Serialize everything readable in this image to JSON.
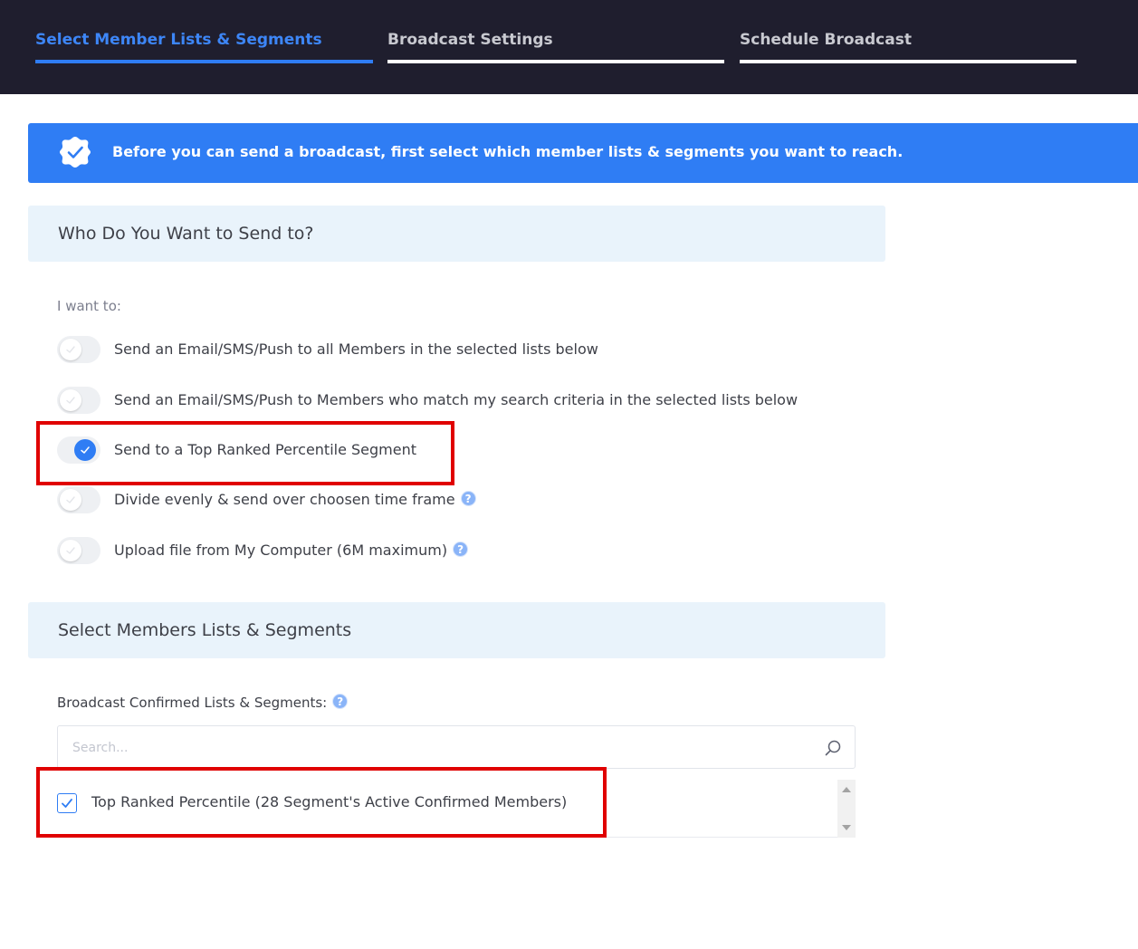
{
  "tabs": [
    {
      "label": "Select Member Lists & Segments",
      "active": true
    },
    {
      "label": "Broadcast Settings",
      "active": false
    },
    {
      "label": "Schedule Broadcast",
      "active": false
    }
  ],
  "banner": {
    "text": "Before you can send a broadcast, first select which member lists & segments you want to reach.",
    "icon": "check-badge-icon"
  },
  "send_section": {
    "title": "Who Do You Want to Send to?",
    "intro": "I want to:",
    "options": [
      {
        "label": "Send an Email/SMS/Push to all Members in the selected lists below",
        "on": false,
        "help": false
      },
      {
        "label": "Send an Email/SMS/Push to Members who match my search criteria in the selected lists below",
        "on": false,
        "help": false
      },
      {
        "label": "Send to a Top Ranked Percentile Segment",
        "on": true,
        "help": false
      },
      {
        "label": "Divide evenly & send over choosen time frame",
        "on": false,
        "help": true
      },
      {
        "label": "Upload file from My Computer (6M maximum)",
        "on": false,
        "help": true
      }
    ]
  },
  "lists_section": {
    "title": "Select Members Lists & Segments",
    "caption": "Broadcast Confirmed Lists & Segments:",
    "search_placeholder": "Search...",
    "search_value": "",
    "items": [
      {
        "label": "Top Ranked Percentile (28 Segment's Active Confirmed Members)",
        "checked": true
      }
    ]
  },
  "help_glyph": "?",
  "colors": {
    "topbar": "#1f1e2e",
    "accent": "#2f7df4",
    "inactive_tab_text": "#c8c9d0",
    "section_bg": "#e9f3fb",
    "highlight": "#e00000"
  }
}
